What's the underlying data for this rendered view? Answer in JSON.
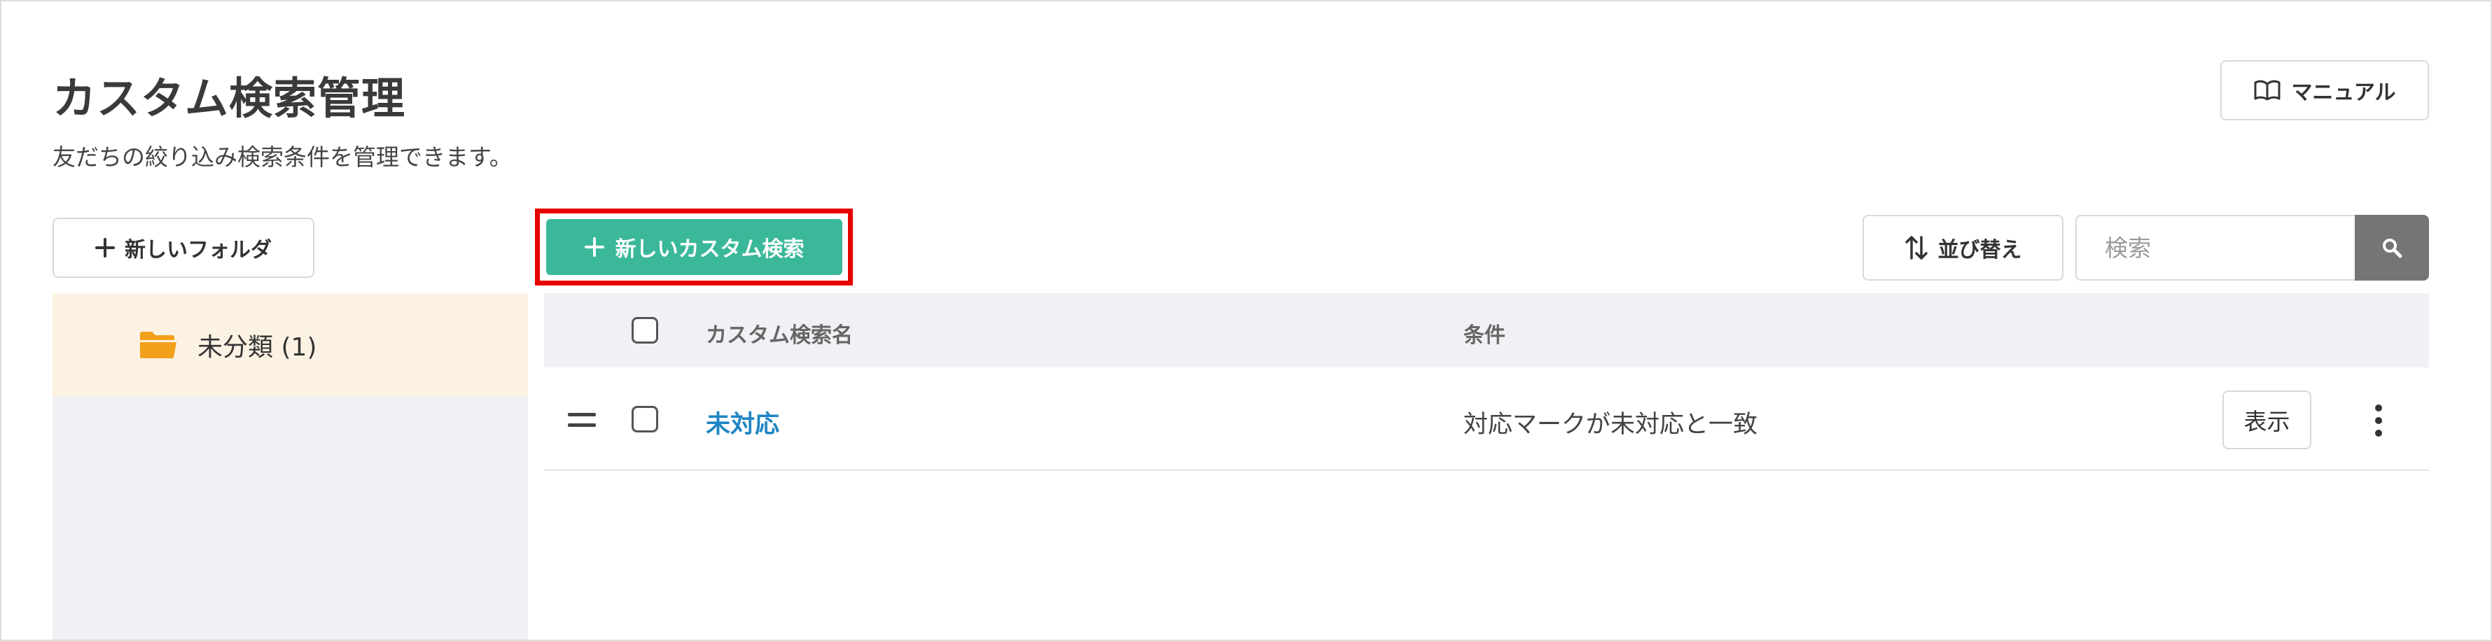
{
  "header": {
    "title": "カスタム検索管理",
    "subtitle": "友だちの絞り込み検索条件を管理できます。",
    "manual_label": "マニュアル"
  },
  "toolbar": {
    "new_folder_label": "新しいフォルダ",
    "new_custom_search_label": "新しいカスタム検索",
    "sort_label": "並び替え",
    "search_placeholder": "検索"
  },
  "sidebar": {
    "folders": [
      {
        "label": "未分類 (1)",
        "selected": true
      }
    ]
  },
  "table": {
    "columns": {
      "name": "カスタム検索名",
      "condition": "条件"
    },
    "rows": [
      {
        "name": "未対応",
        "condition": "対応マークが未対応と一致",
        "action_label": "表示"
      }
    ]
  },
  "colors": {
    "primary_button": "#3bb89a",
    "highlight_border": "#e60000",
    "link": "#1f85c4",
    "folder_icon": "#f2a01b",
    "folder_selected_bg": "#fcf2e3",
    "panel_bg": "#f0f0f5",
    "search_button": "#757575"
  },
  "icons": {
    "manual": "book-icon",
    "new_folder": "plus-icon",
    "new_custom_search": "plus-icon",
    "sort": "sort-arrows-icon",
    "search": "search-icon",
    "folder": "folder-open-icon",
    "drag": "drag-handle-icon",
    "more": "kebab-menu-icon"
  }
}
